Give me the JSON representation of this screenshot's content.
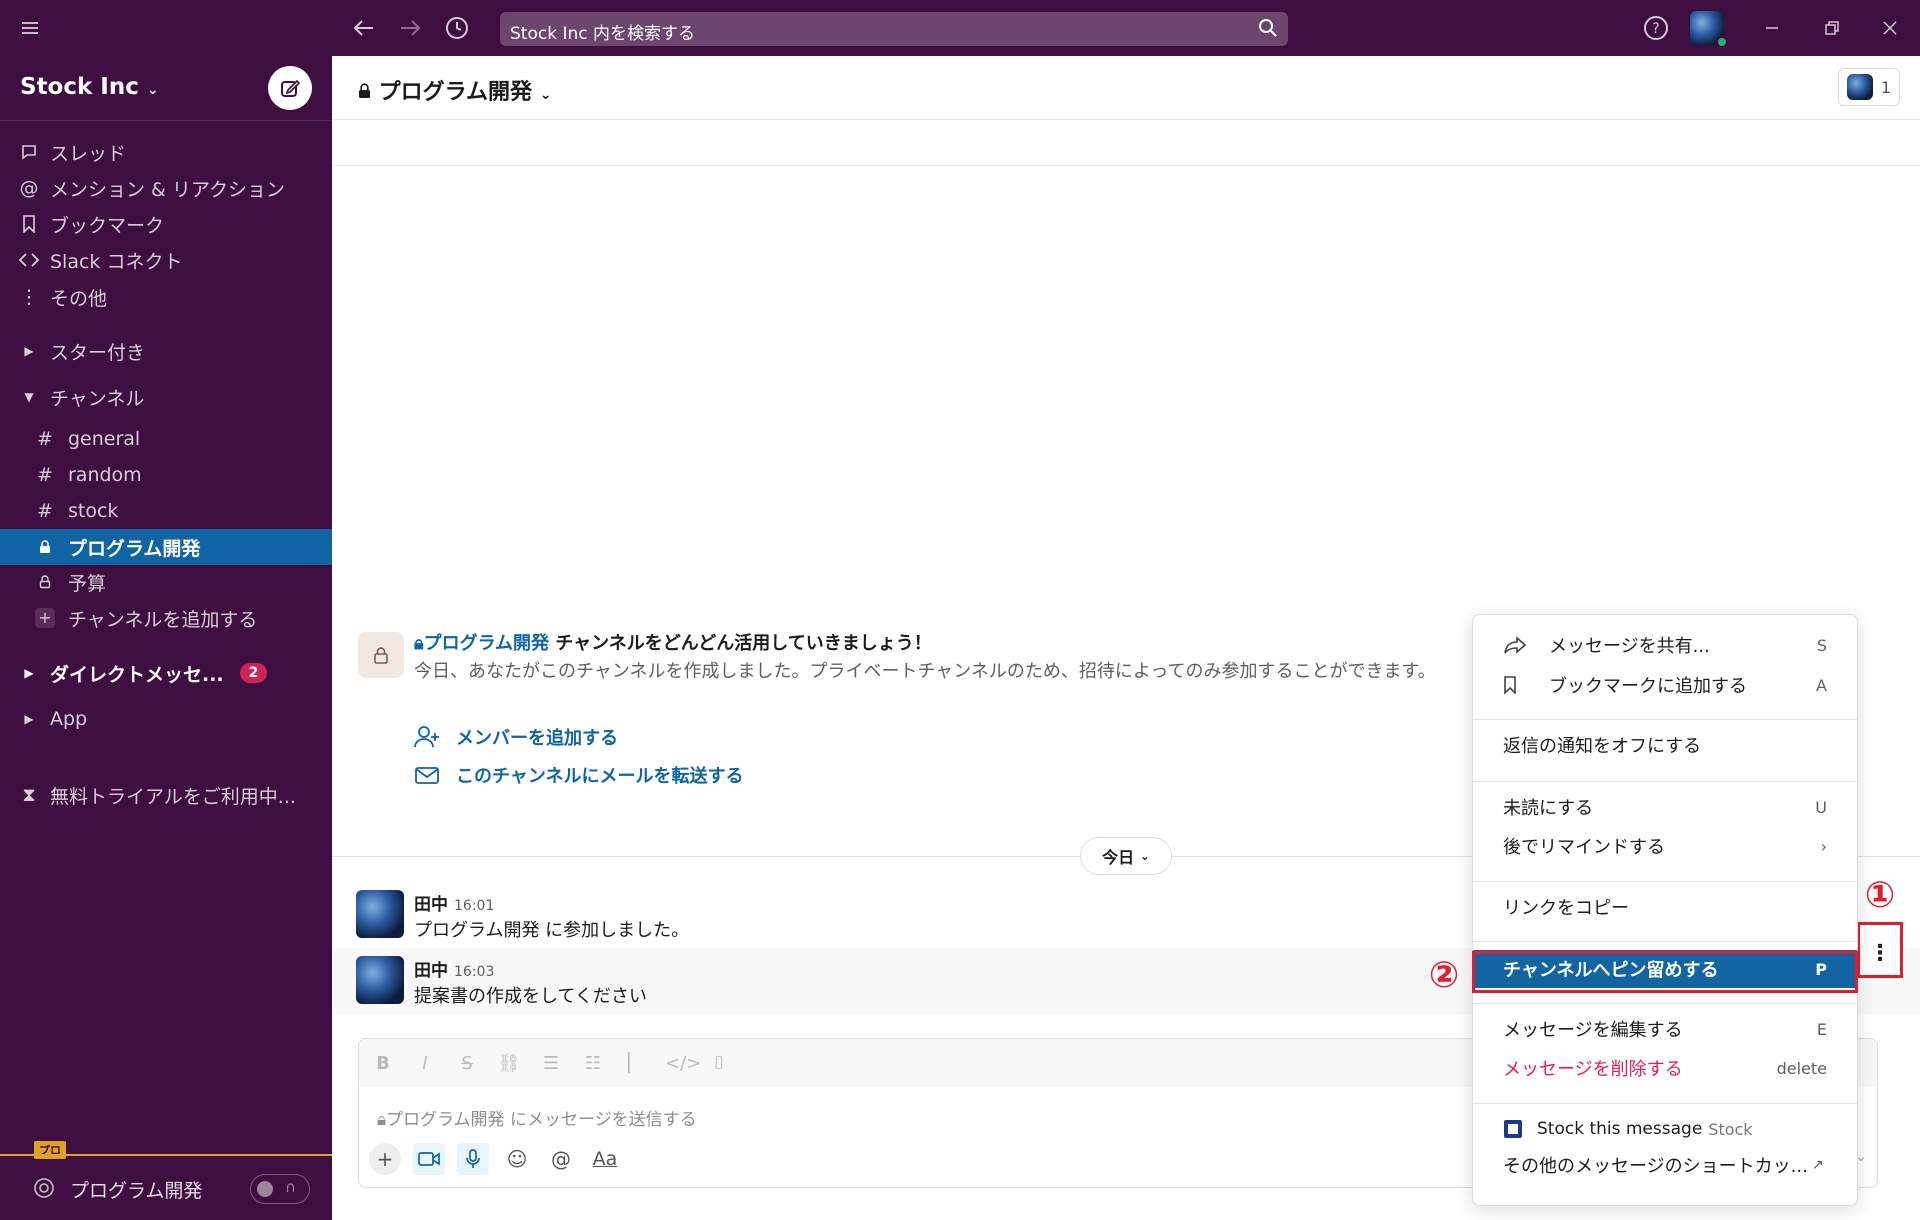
{
  "topbar": {
    "search_placeholder": "Stock Inc 内を検索する"
  },
  "sidebar": {
    "workspace": "Stock Inc",
    "nav": [
      {
        "label": "スレッド"
      },
      {
        "label": "メンション & リアクション"
      },
      {
        "label": "ブックマーク"
      },
      {
        "label": "Slack コネクト"
      },
      {
        "label": "その他"
      }
    ],
    "starred": "スター付き",
    "channels_header": "チャンネル",
    "channels": [
      {
        "prefix": "#",
        "label": "general"
      },
      {
        "prefix": "#",
        "label": "random"
      },
      {
        "prefix": "#",
        "label": "stock"
      },
      {
        "prefix": "lock",
        "label": "プログラム開発"
      },
      {
        "prefix": "lock",
        "label": "予算"
      }
    ],
    "add_channel": "チャンネルを追加する",
    "dm_header": "ダイレクトメッセ...",
    "dm_badge": "2",
    "app_header": "App",
    "trial": "無料トライアルをご利用中...",
    "pro_tag": "プロ",
    "footer_channel": "プログラム開発"
  },
  "channel": {
    "title": "プログラム開発",
    "member_count": "1",
    "intro_channel": "プログラム開発",
    "intro_title": " チャンネルをどんどん活用していきましょう！",
    "intro_desc": "今日、あなたがこのチャンネルを作成しました。プライベートチャンネルのため、招待によってのみ参加することができます。",
    "add_members": "メンバーを追加する",
    "email_forward": "このチャンネルにメールを転送する",
    "day_label": "今日"
  },
  "messages": [
    {
      "author": "田中",
      "time": "16:01",
      "text": "プログラム開発 に参加しました。"
    },
    {
      "author": "田中",
      "time": "16:03",
      "text": "提案書の作成をしてください"
    }
  ],
  "composer": {
    "placeholder": "プログラム開発 にメッセージを送信する",
    "format_label": "Aa"
  },
  "menu": {
    "share": {
      "label": "メッセージを共有...",
      "key": "S"
    },
    "bookmark": {
      "label": "ブックマークに追加する",
      "key": "A"
    },
    "reply_notify": {
      "label": "返信の通知をオフにする"
    },
    "unread": {
      "label": "未読にする",
      "key": "U"
    },
    "remind": {
      "label": "後でリマインドする",
      "key": "›"
    },
    "copy_link": {
      "label": "リンクをコピー"
    },
    "pin": {
      "label": "チャンネルへピン留めする",
      "key": "P"
    },
    "edit": {
      "label": "メッセージを編集する",
      "key": "E"
    },
    "delete": {
      "label": "メッセージを削除する",
      "key": "delete"
    },
    "stock": {
      "label": "Stock this message",
      "app": "Stock"
    },
    "more_shortcuts": {
      "label": "その他のメッセージのショートカッ..."
    }
  },
  "annotations": {
    "step1": "①",
    "step2": "②"
  },
  "colors": {
    "sidebar": "#3f0e40",
    "accent": "#1264a3",
    "danger": "#e01e5a",
    "highlight_box": "#e01e30"
  }
}
